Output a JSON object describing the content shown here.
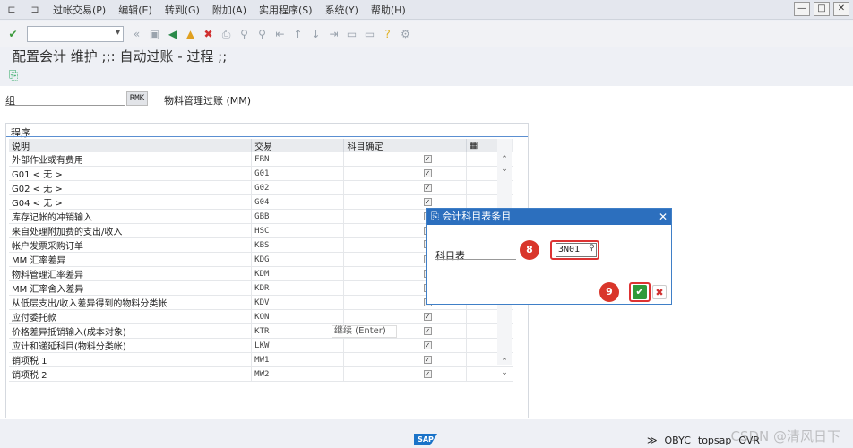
{
  "menu": {
    "items": [
      "过帐交易(P)",
      "编辑(E)",
      "转到(G)",
      "附加(A)",
      "实用程序(S)",
      "系统(Y)",
      "帮助(H)"
    ],
    "window_buttons": [
      "—",
      "□",
      "✕"
    ]
  },
  "page_title": "配置会计 维护 ;;: 自动过账 - 过程 ;;",
  "group": {
    "label": "组",
    "value": "RMK",
    "description": "物料管理过账 (MM)"
  },
  "procedures": {
    "title": "程序",
    "columns": [
      "说明",
      "交易",
      "科目确定"
    ],
    "rows": [
      {
        "desc": "外部作业或有费用",
        "code": "FRN",
        "checked": true
      },
      {
        "desc": "G01 < 无 >",
        "code": "G01",
        "checked": true
      },
      {
        "desc": "G02 < 无 >",
        "code": "G02",
        "checked": true
      },
      {
        "desc": "G04 < 无 >",
        "code": "G04",
        "checked": true
      },
      {
        "desc": "库存记帐的冲销输入",
        "code": "GBB",
        "checked": true
      },
      {
        "desc": "来自处理附加费的支出/收入",
        "code": "HSC",
        "checked": true
      },
      {
        "desc": "帐户发票采购订单",
        "code": "KBS",
        "checked": false
      },
      {
        "desc": "MM 汇率差异",
        "code": "KDG",
        "checked": true
      },
      {
        "desc": "物料管理汇率差异",
        "code": "KDM",
        "checked": true
      },
      {
        "desc": "MM 汇率舍入差异",
        "code": "KDR",
        "checked": true
      },
      {
        "desc": "从低层支出/收入差异得到的物料分类帐",
        "code": "KDV",
        "checked": true
      },
      {
        "desc": "应付委托款",
        "code": "KON",
        "checked": true
      },
      {
        "desc": "价格差异抵销输入(成本对象)",
        "code": "KTR",
        "checked": true
      },
      {
        "desc": "应计和递延科目(物料分类帐)",
        "code": "LKW",
        "checked": true
      },
      {
        "desc": "销项税 1",
        "code": "MW1",
        "checked": true
      },
      {
        "desc": "销项税 2",
        "code": "MW2",
        "checked": true
      }
    ]
  },
  "tooltip": "继续 (Enter)",
  "dialog": {
    "title": "会计科目表条目",
    "field_label": "科目表",
    "field_value": "3N01",
    "marker_field": "8",
    "marker_ok": "9"
  },
  "status": {
    "logo": "SAP",
    "items": [
      "OBYC",
      "topsap",
      "OVR"
    ]
  },
  "watermark": "CSDN @清风日下"
}
